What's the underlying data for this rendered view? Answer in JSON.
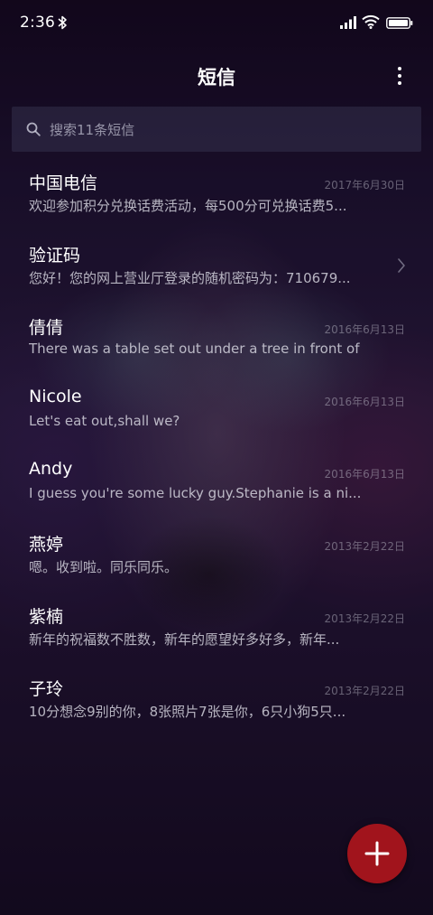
{
  "status_bar": {
    "time": "2:36",
    "icons": [
      "bluetooth-icon",
      "signal-icon",
      "wifi-icon",
      "battery-icon"
    ]
  },
  "app_bar": {
    "title": "短信",
    "menu_icon": "more-vertical-icon"
  },
  "search": {
    "placeholder": "搜索11条短信",
    "icon": "search-icon"
  },
  "messages": [
    {
      "name": "中国电信",
      "date": "2017年6月30日",
      "preview": "欢迎参加积分兑换话费活动，每500分可兑换话费5..."
    },
    {
      "name": "验证码",
      "date": "",
      "preview": "您好！您的网上营业厅登录的随机密码为：710679..."
    },
    {
      "name": "倩倩",
      "date": "2016年6月13日",
      "preview": "There was a table set out under a tree in front of ..."
    },
    {
      "name": "Nicole",
      "date": "2016年6月13日",
      "preview": "Let's eat out,shall we?"
    },
    {
      "name": "Andy",
      "date": "2016年6月13日",
      "preview": "I guess you're some lucky guy.Stephanie is a ni..."
    },
    {
      "name": "燕婷",
      "date": "2013年2月22日",
      "preview": "嗯。收到啦。同乐同乐。"
    },
    {
      "name": "紫楠",
      "date": "2013年2月22日",
      "preview": "新年的祝福数不胜数，新年的愿望好多好多，新年..."
    },
    {
      "name": "子玲",
      "date": "2013年2月22日",
      "preview": "10分想念9别的你，8张照片7张是你，6只小狗5只..."
    }
  ],
  "fab": {
    "icon": "plus-icon",
    "color": "#a1141c"
  }
}
